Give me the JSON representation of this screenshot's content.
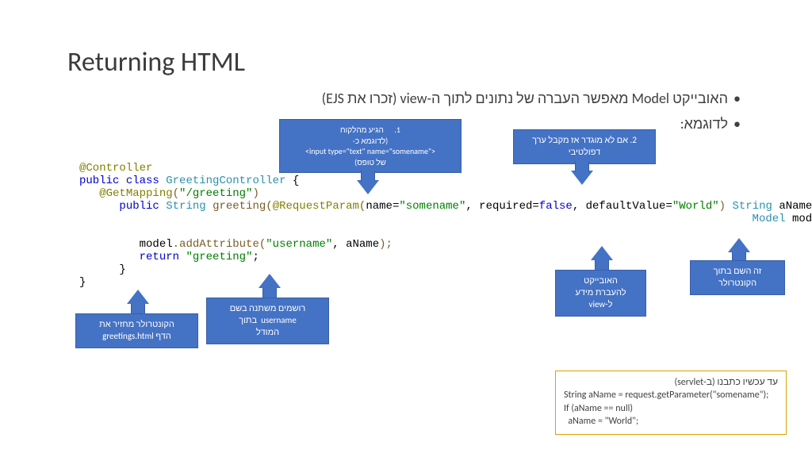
{
  "title": "Returning HTML",
  "bullets": {
    "b1": "האובייקט Model מאפשר העברה של נתונים לתוך ה-view (זכרו את EJS)",
    "b2": "לדוגמא:"
  },
  "callouts": {
    "c1": {
      "line1": "1.      הגיע מהלקוח",
      "line2": "(לדוגמא כ-",
      "line3": "<input type=\"text\" name=\"somename\">",
      "line4": "של טופס)"
    },
    "c2": {
      "line1": "2. אם לא מוגדר אז מקבל ערך",
      "line2": "דפולטיבי"
    },
    "c3": {
      "line1": "זה השם בתוך",
      "line2": "הקונטרולר"
    },
    "c4": {
      "line1": "האובייקט",
      "line2": "להעברת מידע",
      "line3": "ל-view"
    },
    "c5": {
      "line1": "רושמים משתנה בשם",
      "line2": "username  בתוך",
      "line3": "המודל"
    },
    "c6": {
      "line1": "הקונטרולר מחזיר את",
      "line2": "הדף greetings.html"
    }
  },
  "servlet": {
    "header": "עד עכשיו כתבנו (ב-servlet)",
    "l1": "String aName = request.getParameter(\"somename\");",
    "l2": "If (aName == null)",
    "l3": "  aName = \"World\";"
  },
  "code": {
    "at_controller": "@Controller",
    "kw_public": "public",
    "kw_class": "class",
    "cls_name": "GreetingController",
    "brace_open": "{",
    "at_get": "@GetMapping",
    "paren_open": "(",
    "str_greeting": "\"/greeting\"",
    "paren_close": ")",
    "kw_public2": "public",
    "ret_type": "String",
    "m_greeting": "greeting",
    "at_reqparam": "@RequestParam",
    "p_name": "name",
    "eq": "=",
    "str_somename": "\"somename\"",
    "comma": ",",
    "p_required": "required",
    "false": "false",
    "p_default": "defaultValue",
    "str_world": "\"World\"",
    "t_string": "String",
    "v_aName": "aName",
    "t_model": "Model",
    "v_model": "model",
    "brace_open2": "{",
    "blank": "",
    "stmt1a": "model",
    "stmt1b": ".addAttribute",
    "stmt1c": "(",
    "str_username": "\"username\"",
    "stmt1d": ", aName",
    "stmt1e": ");",
    "kw_return": "return",
    "str_greet2": "\"greeting\"",
    "semi": ";",
    "brace_close1": "}",
    "brace_close2": "}"
  }
}
